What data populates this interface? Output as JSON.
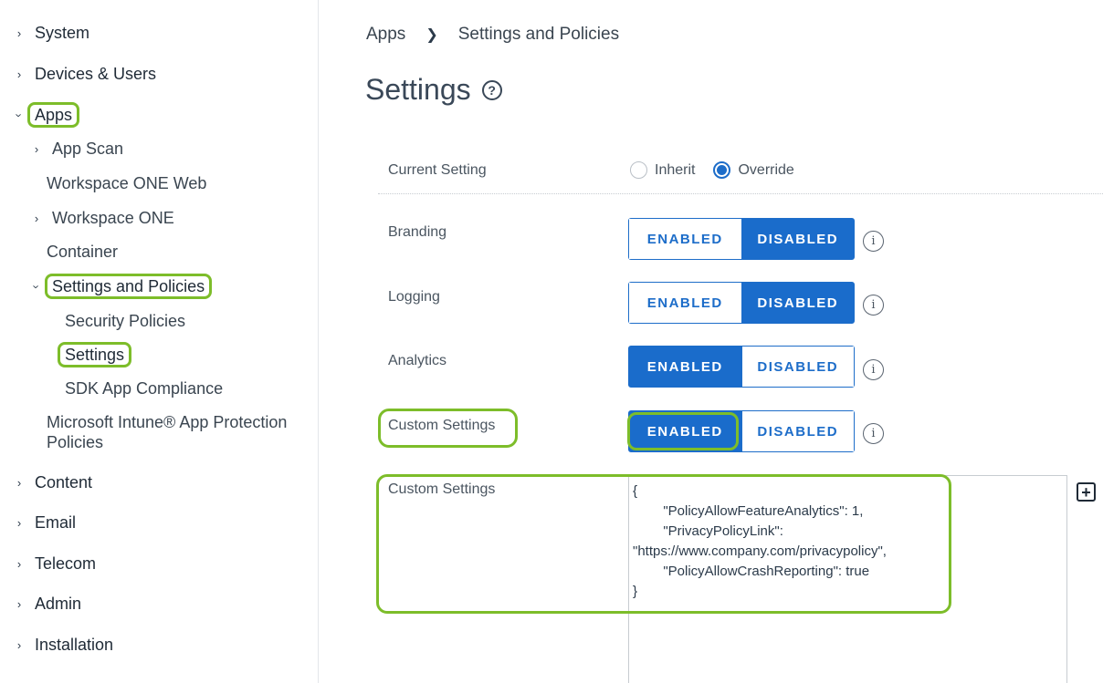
{
  "sidebar": {
    "items": [
      {
        "label": "System"
      },
      {
        "label": "Devices & Users"
      },
      {
        "label": "Apps"
      },
      {
        "label": "App Scan"
      },
      {
        "label": "Workspace ONE Web"
      },
      {
        "label": "Workspace ONE"
      },
      {
        "label": "Container"
      },
      {
        "label": "Settings and Policies"
      },
      {
        "label": "Security Policies"
      },
      {
        "label": "Settings"
      },
      {
        "label": "SDK App Compliance"
      },
      {
        "label": "Microsoft Intune® App Protection Policies"
      },
      {
        "label": "Content"
      },
      {
        "label": "Email"
      },
      {
        "label": "Telecom"
      },
      {
        "label": "Admin"
      },
      {
        "label": "Installation"
      }
    ]
  },
  "breadcrumb": {
    "root": "Apps",
    "current": "Settings and Policies"
  },
  "page": {
    "title": "Settings"
  },
  "form": {
    "current_setting": {
      "label": "Current Setting",
      "options": [
        "Inherit",
        "Override"
      ],
      "selected": "Override"
    },
    "toggles": [
      {
        "label": "Branding",
        "enabled": "ENABLED",
        "disabled": "DISABLED",
        "value": "DISABLED"
      },
      {
        "label": "Logging",
        "enabled": "ENABLED",
        "disabled": "DISABLED",
        "value": "DISABLED"
      },
      {
        "label": "Analytics",
        "enabled": "ENABLED",
        "disabled": "DISABLED",
        "value": "ENABLED"
      },
      {
        "label": "Custom Settings",
        "enabled": "ENABLED",
        "disabled": "DISABLED",
        "value": "ENABLED"
      }
    ],
    "custom_settings": {
      "label": "Custom Settings",
      "lines": [
        "{",
        "        \"PolicyAllowFeatureAnalytics\": 1,",
        "        \"PrivacyPolicyLink\":",
        "\"https://www.company.com/privacypolicy\",",
        "        \"PolicyAllowCrashReporting\": true",
        "}"
      ]
    }
  },
  "colors": {
    "accent": "#1a6ccb",
    "highlight": "#7dbd2a"
  }
}
